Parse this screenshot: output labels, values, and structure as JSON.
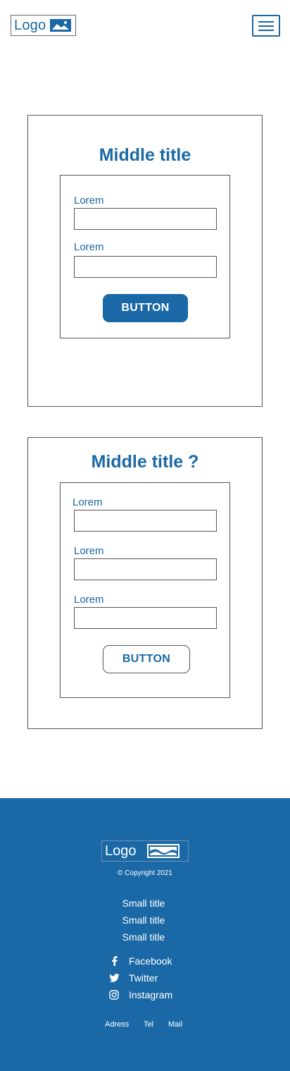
{
  "header": {
    "logo_text": "Logo",
    "logo_icon": "image-icon",
    "menu_icon": "hamburger-menu-icon"
  },
  "form1": {
    "title": "Middle title",
    "fields": [
      {
        "label": "Lorem",
        "value": "",
        "placeholder": ""
      },
      {
        "label": "Lorem",
        "value": "",
        "placeholder": ""
      }
    ],
    "button_label": "BUTTON"
  },
  "form2": {
    "title": "Middle title ?",
    "fields": [
      {
        "label": "Lorem",
        "value": "",
        "placeholder": ""
      },
      {
        "label": "Lorem",
        "value": "",
        "placeholder": ""
      },
      {
        "label": "Lorem",
        "value": "",
        "placeholder": ""
      }
    ],
    "button_label": "BUTTON"
  },
  "footer": {
    "logo_text": "Logo",
    "copyright": "© Copyright 2021",
    "small_titles": [
      "Small title",
      "Small title",
      "Small title"
    ],
    "social": [
      {
        "label": "Facebook",
        "icon": "facebook-icon"
      },
      {
        "label": "Twitter",
        "icon": "twitter-icon"
      },
      {
        "label": "Instagram",
        "icon": "instagram-icon"
      }
    ],
    "contact": [
      "Adress",
      "Tel",
      "Mail"
    ]
  },
  "colors": {
    "brand": "#1a68a5",
    "border": "#555555",
    "background": "#ffffff"
  }
}
